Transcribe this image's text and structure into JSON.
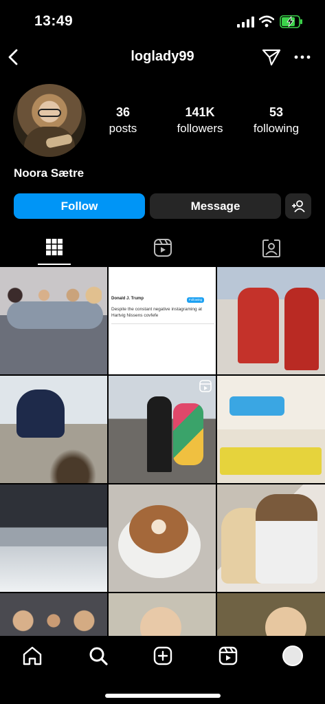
{
  "status_bar": {
    "time": "13:49"
  },
  "header": {
    "username": "loglady99"
  },
  "profile": {
    "display_name": "Noora Sætre",
    "stats": [
      {
        "value": "36",
        "label": "posts"
      },
      {
        "value": "141K",
        "label": "followers"
      },
      {
        "value": "53",
        "label": "following"
      }
    ]
  },
  "actions": {
    "follow_label": "Follow",
    "message_label": "Message"
  },
  "tabs": [
    {
      "name": "posts-grid",
      "icon": "grid-icon",
      "active": true
    },
    {
      "name": "reels",
      "icon": "reels-icon",
      "active": false
    },
    {
      "name": "tagged",
      "icon": "tagged-icon",
      "active": false
    }
  ],
  "tweet": {
    "author": "Donald J. Trump",
    "follow_label": "Following",
    "text": "Despite the constant negative instagraming at Hartvig Nissens covfefe"
  },
  "bottom_nav": [
    "home-icon",
    "search-icon",
    "create-icon",
    "reels-icon",
    "profile-avatar"
  ],
  "colors": {
    "accent": "#0095f6",
    "button_secondary": "#262626",
    "background": "#000000"
  }
}
